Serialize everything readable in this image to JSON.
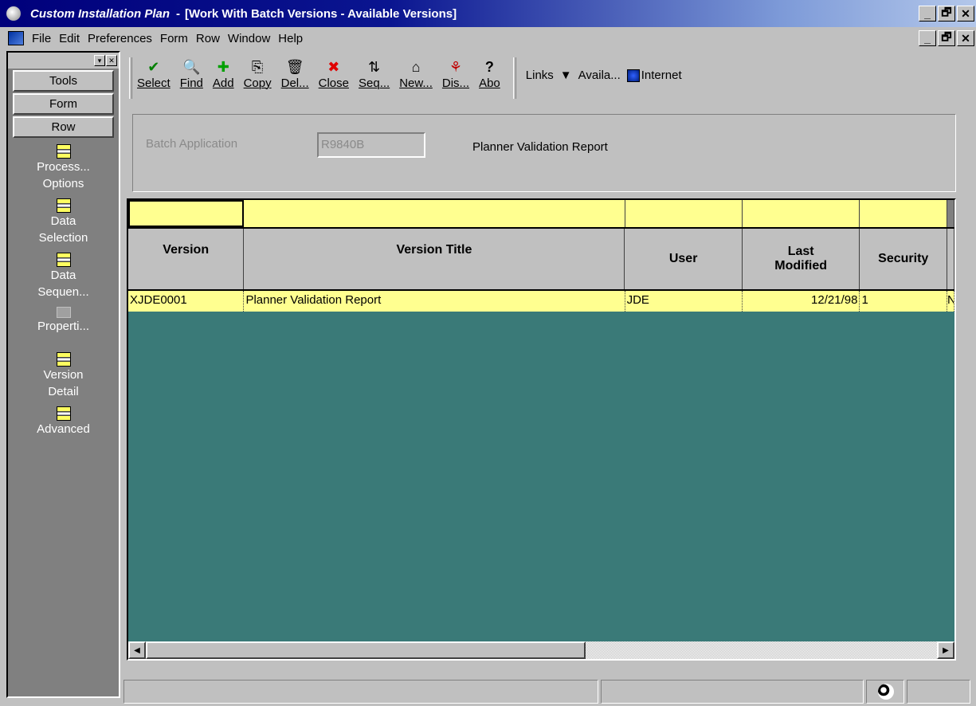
{
  "window": {
    "app_title": "Custom Installation Plan",
    "separator": "-",
    "form_title": "[Work With Batch Versions - Available Versions]",
    "controls": [
      "_",
      "🗗",
      "✕"
    ]
  },
  "menu": [
    "File",
    "Edit",
    "Preferences",
    "Form",
    "Row",
    "Window",
    "Help"
  ],
  "mdi_controls": [
    "_",
    "🗗",
    "✕"
  ],
  "left_panel": {
    "buttons": [
      "Tools",
      "Form",
      "Row"
    ],
    "exits": [
      {
        "label": "Process...\nOptions",
        "icon": "row-exit-icon"
      },
      {
        "label": "Data\nSelection",
        "icon": "row-exit-icon"
      },
      {
        "label": "Data\nSequen...",
        "icon": "row-exit-icon"
      },
      {
        "label": "Properti...",
        "icon": "disabled-exit-icon"
      },
      {
        "label": "Version\nDetail",
        "icon": "row-exit-icon"
      },
      {
        "label": "Advanced",
        "icon": "row-exit-icon"
      }
    ]
  },
  "toolbar": {
    "tools": [
      {
        "label": "Select",
        "icon": "✔",
        "color": "#008000"
      },
      {
        "label": "Find",
        "icon": "🔍",
        "color": "#000000"
      },
      {
        "label": "Add",
        "icon": "✚",
        "color": "#00a000"
      },
      {
        "label": "Copy",
        "icon": "⎘",
        "color": "#000000"
      },
      {
        "label": "Del...",
        "icon": "🗑",
        "color": "#000000"
      },
      {
        "label": "Close",
        "icon": "✖",
        "color": "#e00000"
      },
      {
        "label": "Seq...",
        "icon": "⇅",
        "color": "#000000"
      },
      {
        "label": "New...",
        "icon": "⌂",
        "color": "#000000"
      },
      {
        "label": "Dis...",
        "icon": "⚘",
        "color": "#c00000"
      },
      {
        "label": "Abo",
        "icon": "?",
        "color": "#000000"
      }
    ],
    "links_label": "Links",
    "available_label": "Availa...",
    "internet_label": "Internet"
  },
  "header": {
    "batch_app_label": "Batch Application",
    "batch_app_value": "R9840B",
    "batch_app_desc": "Planner Validation Report"
  },
  "grid": {
    "columns": [
      "Version",
      "Version Title",
      "User",
      "Last Modified",
      "Security"
    ],
    "rows": [
      {
        "version": "XJDE0001",
        "title": "Planner Validation Report",
        "user": "JDE",
        "modified": "12/21/98",
        "security": "1",
        "extra": "N"
      }
    ]
  },
  "colors": {
    "grid_background": "#3a7a78",
    "qbe_row": "#ffff90",
    "title_bar": "#00007b"
  }
}
